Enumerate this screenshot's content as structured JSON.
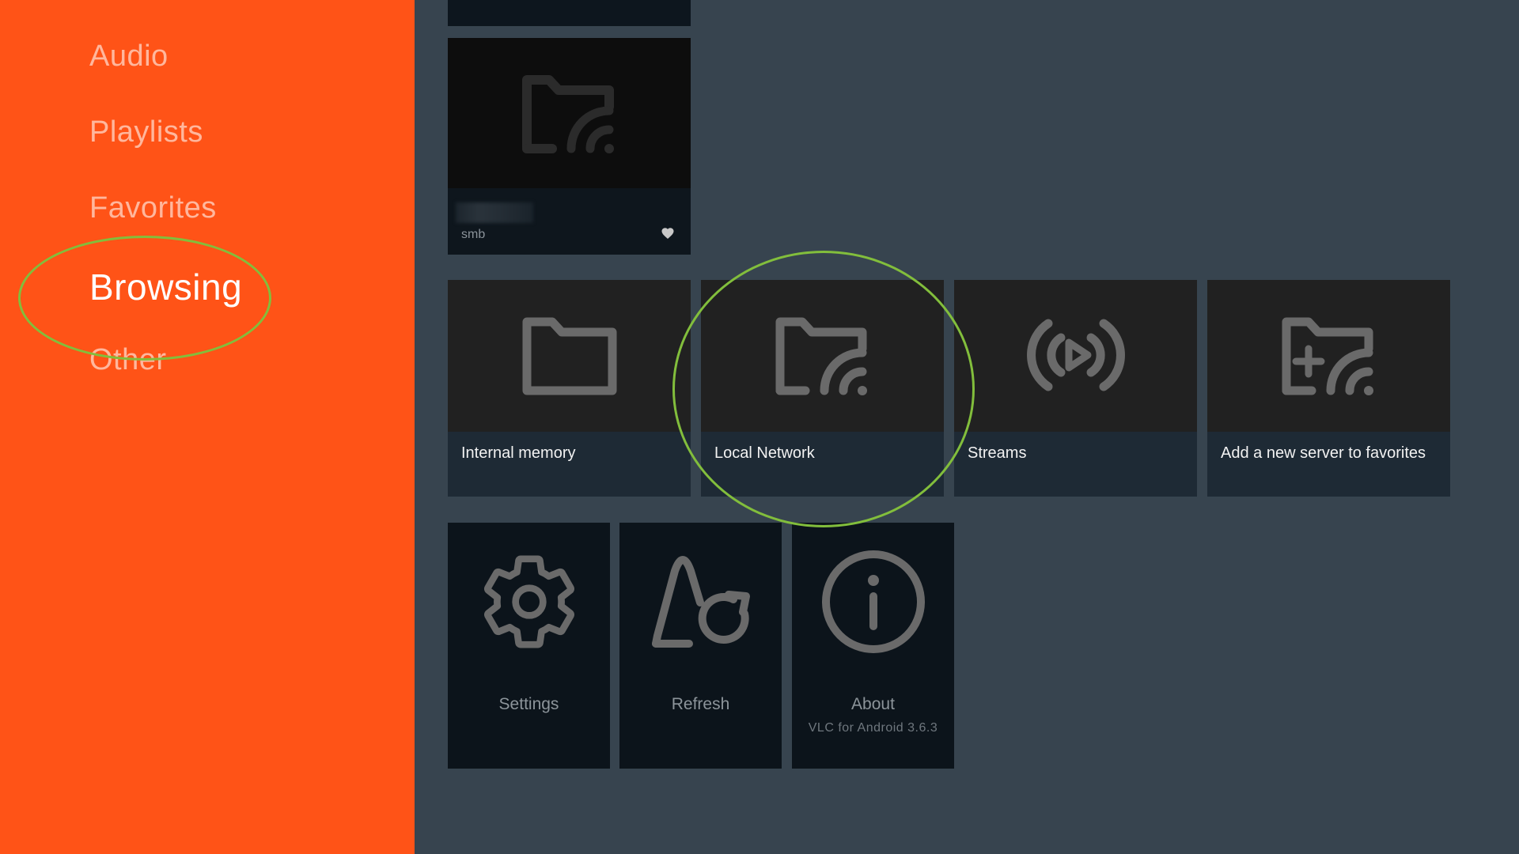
{
  "sidebar": {
    "items": [
      {
        "label": "Audio",
        "active": false
      },
      {
        "label": "Playlists",
        "active": false
      },
      {
        "label": "Favorites",
        "active": false
      },
      {
        "label": "Browsing",
        "active": true
      },
      {
        "label": "Other",
        "active": false
      }
    ],
    "background_color": "#ff5317"
  },
  "favorites": {
    "server": {
      "protocol": "smb",
      "icon": "folder-network-icon",
      "favorited": true
    }
  },
  "browse_cards": [
    {
      "label": "Internal memory",
      "icon": "folder-icon"
    },
    {
      "label": "Local Network",
      "icon": "folder-network-icon"
    },
    {
      "label": "Streams",
      "icon": "stream-icon"
    },
    {
      "label": "Add a new server to favorites",
      "icon": "add-server-icon"
    }
  ],
  "action_cards": [
    {
      "label": "Settings",
      "icon": "gear-icon"
    },
    {
      "label": "Refresh",
      "icon": "refresh-icon"
    },
    {
      "label": "About",
      "sublabel": "VLC for Android 3.6.3",
      "icon": "info-icon"
    }
  ],
  "colors": {
    "accent": "#ff5317",
    "annotation": "#82be3c",
    "main_background": "#37444f"
  }
}
